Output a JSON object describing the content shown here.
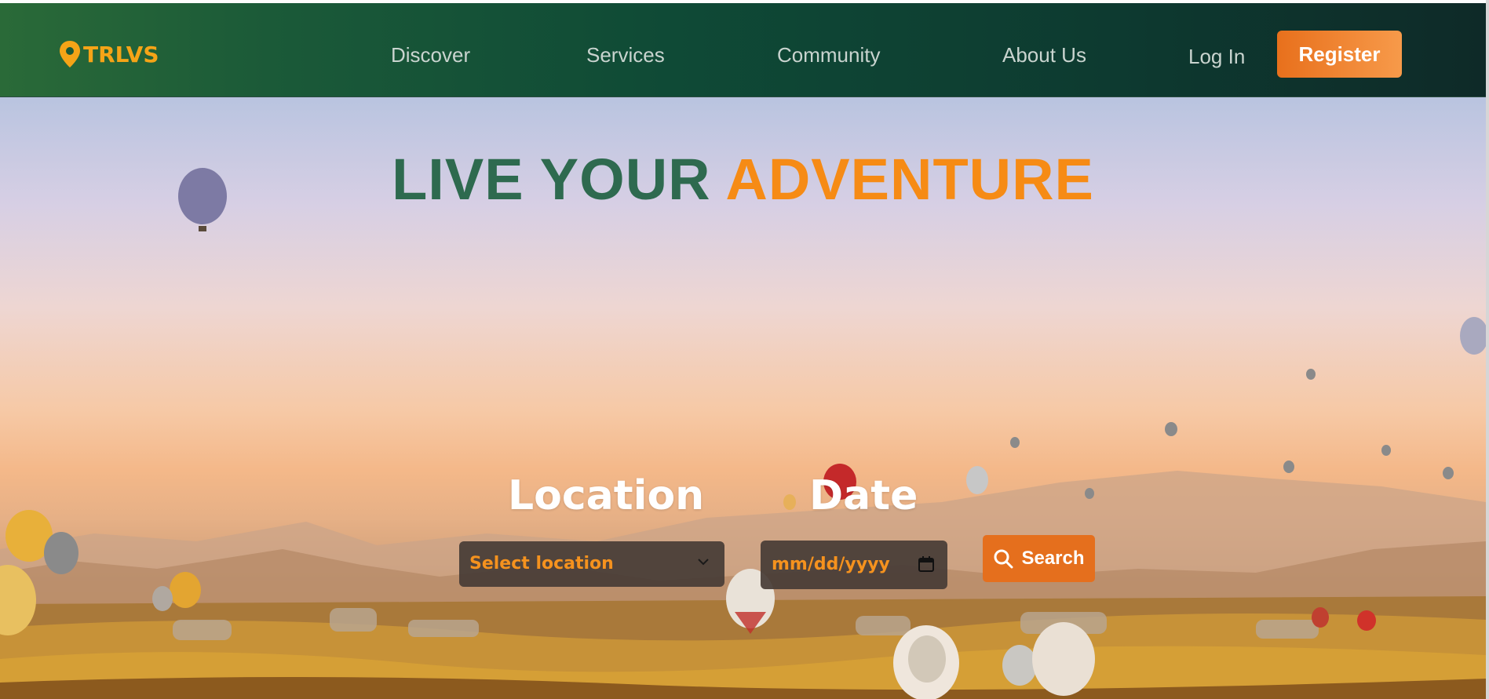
{
  "brand": {
    "name": "TRLVS",
    "icon": "map-pin-icon",
    "color": "#f5a417"
  },
  "nav": {
    "links": [
      "Discover",
      "Services",
      "Community",
      "About Us"
    ],
    "login": "Log In",
    "register": "Register"
  },
  "hero": {
    "headline_part1": "LIVE YOUR",
    "headline_part2": "ADVENTURE",
    "headline_colors": {
      "part1": "#2e6a4f",
      "part2": "#f68b15"
    }
  },
  "search": {
    "location_label": "Location",
    "location_placeholder": "Select location",
    "date_label": "Date",
    "date_placeholder": "mm/dd/yyyy",
    "button_label": "Search"
  },
  "colors": {
    "accent": "#e56f1d",
    "nav_bg": "#0f4a36"
  }
}
